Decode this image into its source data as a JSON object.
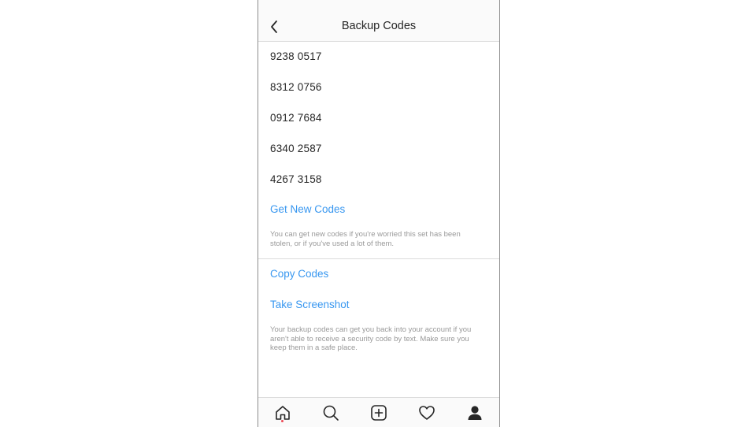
{
  "header": {
    "title": "Backup Codes",
    "back_icon": "chevron-left-icon"
  },
  "codes": [
    "9238 0517",
    "8312 0756",
    "0912 7684",
    "6340 2587",
    "4267 3158"
  ],
  "actions": {
    "get_new_codes": "Get New Codes",
    "get_new_note": "You can get new codes if you're worried this set has been stolen, or if you've used a lot of them.",
    "copy_codes": "Copy Codes",
    "take_screenshot": "Take Screenshot",
    "screenshot_note": "Your backup codes can get you back into your account if you aren't able to receive a security code by text. Make sure you keep them in a safe place."
  },
  "tabbar": {
    "items": [
      "home-icon",
      "search-icon",
      "add-post-icon",
      "heart-icon",
      "profile-icon"
    ],
    "notification_dot_color": "#ed4956"
  },
  "colors": {
    "link": "#3897f0",
    "text": "#262626",
    "muted": "#999999"
  }
}
